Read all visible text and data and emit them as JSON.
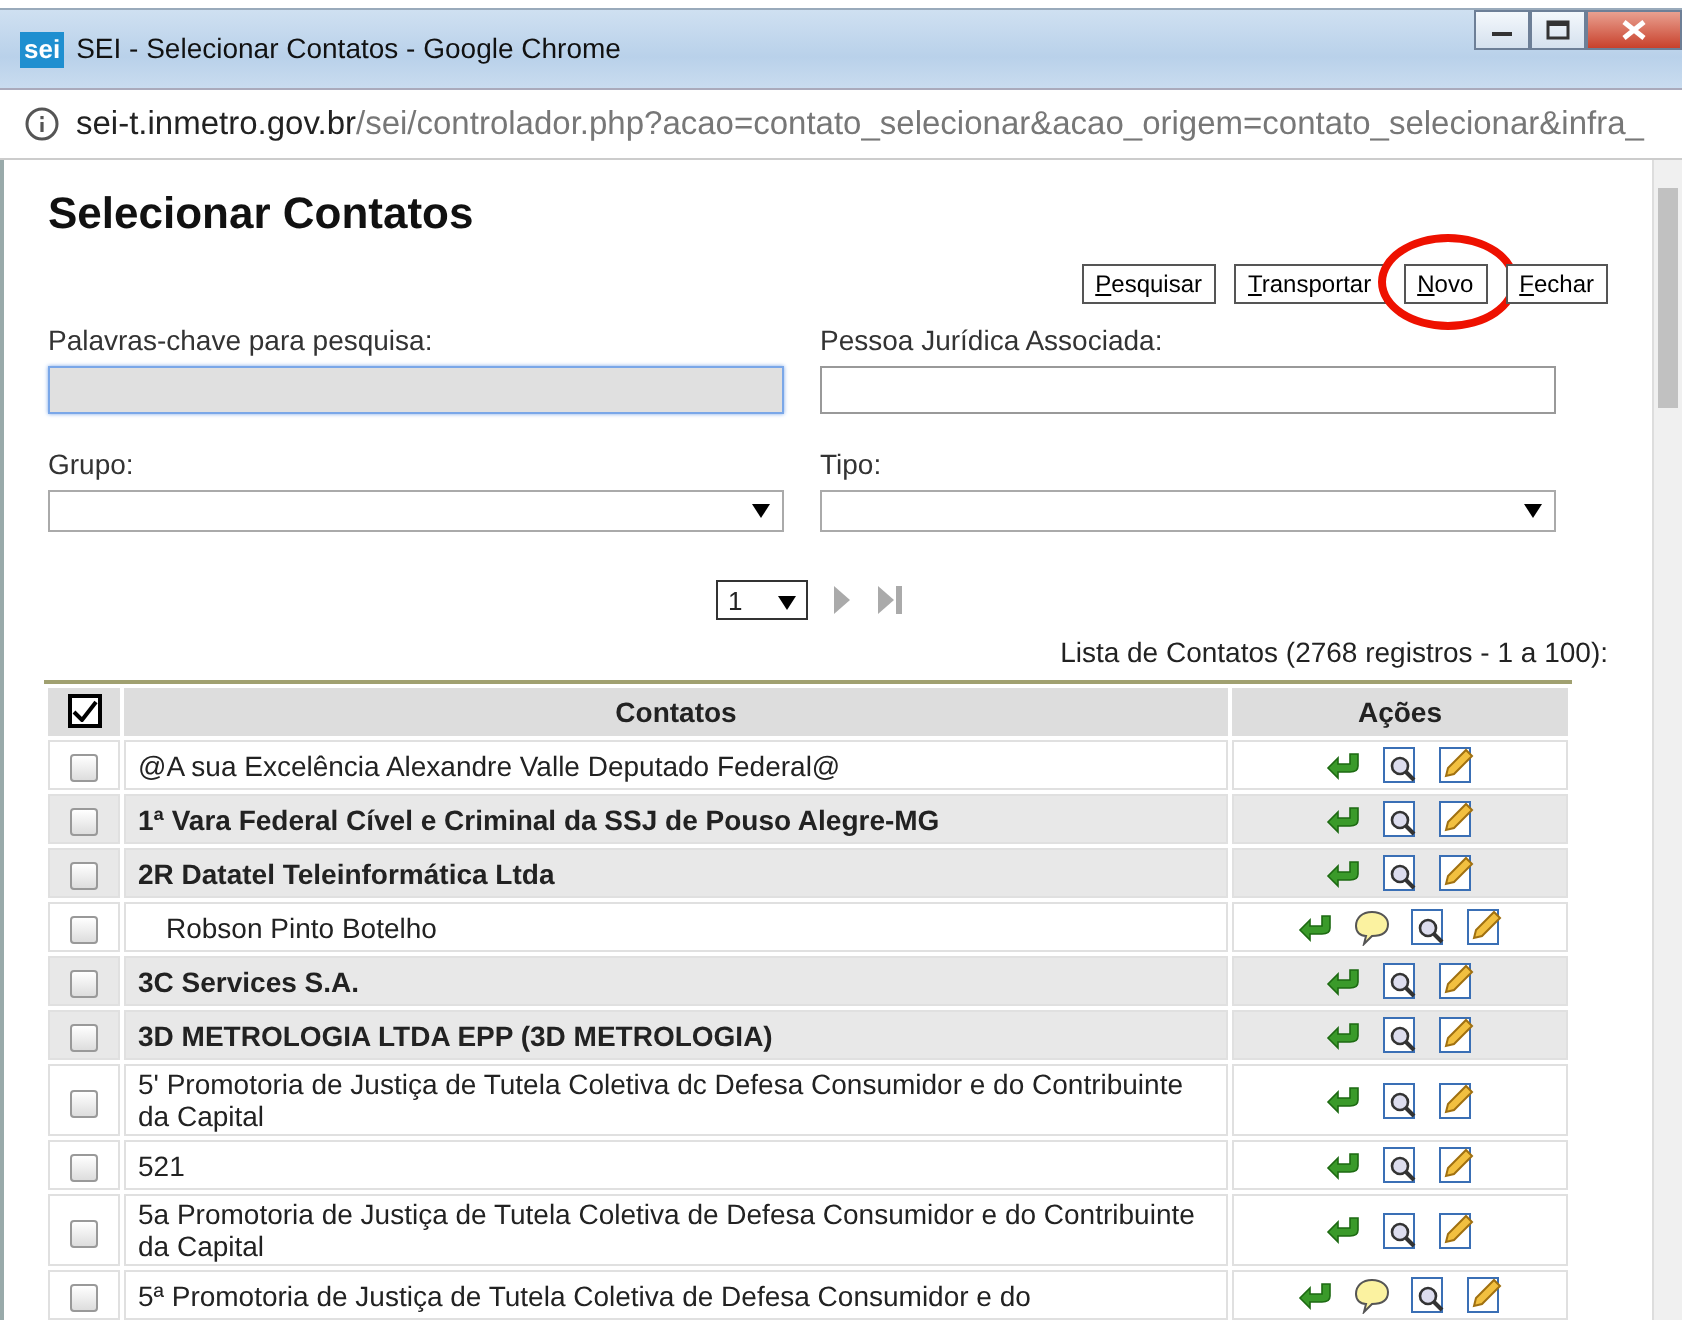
{
  "window": {
    "logo": "sei",
    "title": "SEI - Selecionar Contatos - Google Chrome"
  },
  "address_bar": {
    "host": "sei-t.inmetro.gov.br",
    "path": "/sei/controlador.php?acao=contato_selecionar&acao_origem=contato_selecionar&infra_"
  },
  "page": {
    "heading": "Selecionar Contatos",
    "buttons": [
      {
        "label": "Pesquisar",
        "access_key_underlined": true,
        "highlighted": false
      },
      {
        "label": "Transportar",
        "access_key_underlined": true,
        "highlighted": false
      },
      {
        "label": "Novo",
        "access_key_underlined": true,
        "highlighted": true
      },
      {
        "label": "Fechar",
        "access_key_underlined": true,
        "highlighted": false
      }
    ],
    "fields": [
      {
        "kind": "text",
        "label": "Palavras-chave para pesquisa:",
        "focused": true
      },
      {
        "kind": "text",
        "label": "Pessoa Jurídica Associada:",
        "focused": false
      },
      {
        "kind": "select",
        "label": "Grupo:"
      },
      {
        "kind": "select",
        "label": "Tipo:"
      }
    ],
    "pager": {
      "page": "1"
    },
    "table": {
      "caption": "Lista de Contatos (2768 registros - 1 a 100):",
      "select_all_checked": true,
      "columns": [
        "Contatos",
        "Ações"
      ],
      "rows": [
        {
          "name": "@A sua Excelência Alexandre Valle Deputado Federal@",
          "organization": false,
          "indented": false,
          "note": false,
          "checked": false
        },
        {
          "name": "1ª Vara Federal Cível e Criminal da SSJ de Pouso Alegre-MG",
          "organization": true,
          "indented": false,
          "note": false,
          "checked": false
        },
        {
          "name": "2R Datatel Teleinformática Ltda",
          "organization": true,
          "indented": false,
          "note": false,
          "checked": false
        },
        {
          "name": "Robson Pinto Botelho",
          "organization": false,
          "indented": true,
          "note": true,
          "checked": false
        },
        {
          "name": "3C Services S.A.",
          "organization": true,
          "indented": false,
          "note": false,
          "checked": false
        },
        {
          "name": "3D METROLOGIA LTDA EPP (3D METROLOGIA)",
          "organization": true,
          "indented": false,
          "note": false,
          "checked": false
        },
        {
          "name": "5' Promotoria de Justiça de Tutela Coletiva dc Defesa Consumidor e do Contribuinte da Capital",
          "organization": false,
          "indented": false,
          "note": false,
          "checked": false
        },
        {
          "name": "521",
          "organization": false,
          "indented": false,
          "note": false,
          "checked": false
        },
        {
          "name": "5a Promotoria de Justiça de Tutela Coletiva de Defesa Consumidor e do Contribuinte da Capital",
          "organization": false,
          "indented": false,
          "note": false,
          "checked": false
        },
        {
          "name": "5ª Promotoria de Justiça de Tutela Coletiva de Defesa Consumidor e do",
          "organization": false,
          "indented": false,
          "note": true,
          "checked": false
        }
      ]
    }
  }
}
